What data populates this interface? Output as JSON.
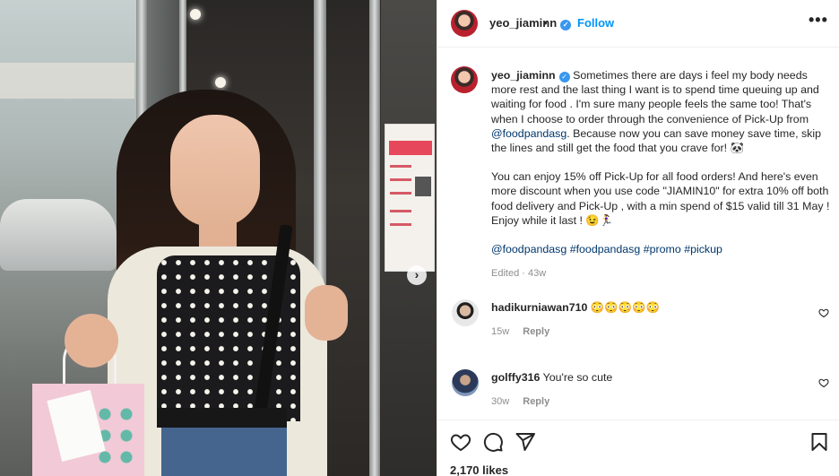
{
  "post": {
    "username": "yeo_jiaminn",
    "follow_label": "Follow",
    "separator": "•",
    "more_label": "•••"
  },
  "caption": {
    "username": "yeo_jiaminn",
    "p1_a": " Sometimes there are days i feel my body needs more rest and the last thing I want is to spend time queuing up and waiting for food . I'm sure many people feels the same too! That's when I choose to order through the convenience of Pick-Up from ",
    "p1_mention": "@foodpandasg",
    "p1_b": ". Because now you can save money save time, skip the lines and still get the food that you crave for! 🐼",
    "p2": "You can enjoy 15% off Pick-Up for all food orders! And here's even more discount when you use code \"JIAMIN10\" for extra 10% off both food delivery and Pick-Up , with a min spend of $15 valid till 31 May ! Enjoy while it last ! 😉🏃‍♀️",
    "tags": [
      "@foodpandasg",
      "#foodpandasg",
      "#promo",
      "#pickup"
    ],
    "edited": "Edited · 43w"
  },
  "comments": [
    {
      "username": "hadikurniawan710",
      "text": "😳😳😳😳😳",
      "age": "15w",
      "reply_label": "Reply"
    },
    {
      "username": "golffy316",
      "text": "You're so cute",
      "age": "30w",
      "reply_label": "Reply"
    }
  ],
  "likes": "2,170 likes",
  "icons": {
    "verified": "verified-badge-icon",
    "more": "more-options-icon",
    "next": "chevron-right-icon",
    "like": "heart-icon",
    "comment": "comment-bubble-icon",
    "share": "paper-plane-icon",
    "save": "bookmark-icon"
  },
  "colors": {
    "follow": "#0095f6",
    "verified": "#3897f0",
    "link": "#00376b",
    "muted": "#8e8e8e"
  }
}
